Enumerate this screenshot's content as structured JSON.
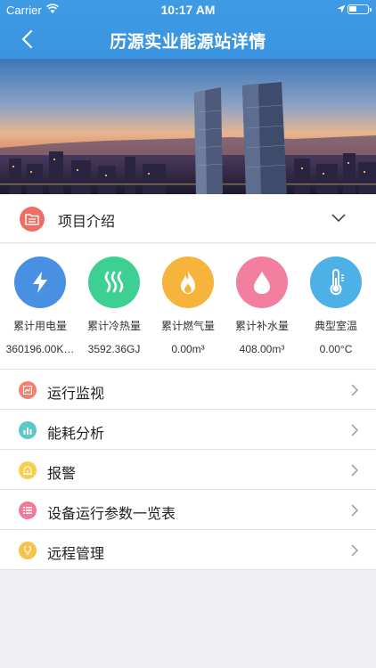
{
  "status_bar": {
    "carrier": "Carrier",
    "time": "10:17 AM"
  },
  "nav": {
    "title": "历源实业能源站详情",
    "back_icon": "chevron-left-icon"
  },
  "intro": {
    "label": "项目介绍",
    "icon": "folder-list-icon",
    "icon_color": "#ee6e63"
  },
  "stats": [
    {
      "name": "累计用电量",
      "value": "360196.00K…",
      "icon": "lightning-icon",
      "color": "#4a90e2"
    },
    {
      "name": "累计冷热量",
      "value": "3592.36GJ",
      "icon": "heat-waves-icon",
      "color": "#3ecf93"
    },
    {
      "name": "累计燃气量",
      "value": "0.00m³",
      "icon": "flame-icon",
      "color": "#f7b43c"
    },
    {
      "name": "累计补水量",
      "value": "408.00m³",
      "icon": "water-drop-icon",
      "color": "#f37fa0"
    },
    {
      "name": "典型室温",
      "value": "0.00°C",
      "icon": "thermometer-icon",
      "color": "#4db1e8"
    }
  ],
  "menu": [
    {
      "label": "运行监视",
      "icon": "monitor-chart-icon",
      "color": "#f0826f"
    },
    {
      "label": "能耗分析",
      "icon": "bar-chart-icon",
      "color": "#5cc9c9"
    },
    {
      "label": "报警",
      "icon": "alarm-icon",
      "color": "#f8cf4f"
    },
    {
      "label": "设备运行参数一览表",
      "icon": "list-icon",
      "color": "#f3799a"
    },
    {
      "label": "远程管理",
      "icon": "bulb-icon",
      "color": "#f7c14a"
    }
  ]
}
